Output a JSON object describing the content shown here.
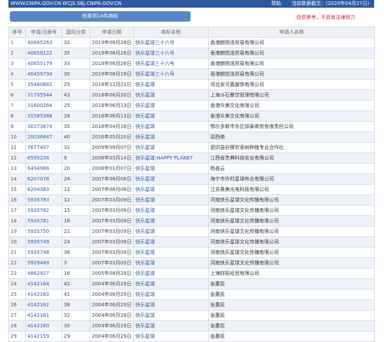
{
  "topbar": {
    "url": "WWW.CNIPA.GOV.CN WCJS.SBJ.CNIPA.GOV.CN",
    "help": "帮助",
    "data_as_of": "当前数据截至：(2020年04月27日)"
  },
  "search": {
    "result_label": "检索到14件商标"
  },
  "disclaimer": "仅供参考，不具有法律效力",
  "table": {
    "headers": [
      "序号",
      "申请/注册号",
      "国际分类",
      "申请日期",
      "商标名称",
      "申请人名称"
    ],
    "rows": [
      {
        "num": "1",
        "reg": "40665263",
        "cls": "32",
        "date": "2019年08月28日",
        "mark": "快乐星球三十六号",
        "applicant": "香港朗悦浩贸易有限公司"
      },
      {
        "num": "2",
        "reg": "40658122",
        "cls": "35",
        "date": "2019年08月28日",
        "mark": "快乐星球三十六号",
        "applicant": "香港朗悦浩贸易有限公司"
      },
      {
        "num": "3",
        "reg": "40655179",
        "cls": "33",
        "date": "2019年08月28日",
        "mark": "快乐星球三十六号",
        "applicant": "香港朗悦浩贸易有限公司"
      },
      {
        "num": "4",
        "reg": "40459734",
        "cls": "30",
        "date": "2019年08月19日",
        "mark": "快乐星球三十六号",
        "applicant": "香港朗悦浩贸易有限公司"
      },
      {
        "num": "5",
        "reg": "35460662",
        "cls": "25",
        "date": "2018年12月21日",
        "mark": "快乐星球",
        "applicant": "河北安可嘉服饰有限公司"
      },
      {
        "num": "6",
        "reg": "31705544",
        "cls": "43",
        "date": "2018年06月20日",
        "mark": "快乐星球",
        "applicant": "上海斗石餐饮管理有限公司"
      },
      {
        "num": "7",
        "reg": "31600264",
        "cls": "25",
        "date": "2018年06月13日",
        "mark": "快乐星球",
        "applicant": "香港众美文化有限公司"
      },
      {
        "num": "8",
        "reg": "31585368",
        "cls": "28",
        "date": "2018年06月13日",
        "mark": "快乐星球",
        "applicant": "香港众美文化有限公司"
      },
      {
        "num": "9",
        "reg": "30273674",
        "cls": "35",
        "date": "2018年04月16日",
        "mark": "快乐星球",
        "applicant": "鄂尔多斯市东区邱泰商贸有限责任公司"
      },
      {
        "num": "10",
        "reg": "20036847",
        "cls": "40",
        "date": "2016年05月20日",
        "mark": "快乐星球",
        "applicant": "梁西艳"
      },
      {
        "num": "11",
        "reg": "7677407",
        "cls": "31",
        "date": "2009年09月07日",
        "mark": "快乐星球",
        "applicant": "泗洪县好楞农家树种植专业合作社"
      },
      {
        "num": "12",
        "reg": "6595226",
        "cls": "9",
        "date": "2008年03月14日",
        "mark": "快乐星球;HAPPY PLANET",
        "applicant": "江西省艺典科技实业有限公司"
      },
      {
        "num": "13",
        "reg": "6494988",
        "cls": "20",
        "date": "2008年01月07日",
        "mark": "快乐星球",
        "applicant": "杨善云"
      },
      {
        "num": "14",
        "reg": "6207078",
        "cls": "24",
        "date": "2007年08月06日",
        "mark": "快乐星球",
        "applicant": "海宁市许村星球布业有限公司"
      },
      {
        "num": "15",
        "reg": "6204383",
        "cls": "12",
        "date": "2007年08月06日",
        "mark": "快乐星球",
        "applicant": "江苏奥美光电科技有限公司"
      },
      {
        "num": "16",
        "reg": "5935783",
        "cls": "12",
        "date": "2007年03月09日",
        "mark": "快乐星球",
        "applicant": "河南快乐星球文化传播有限公司"
      },
      {
        "num": "17",
        "reg": "5935782",
        "cls": "15",
        "date": "2007年03月09日",
        "mark": "快乐星球",
        "applicant": "河南快乐星球文化传播有限公司"
      },
      {
        "num": "18",
        "reg": "5935781",
        "cls": "18",
        "date": "2007年03月09日",
        "mark": "快乐星球",
        "applicant": "河南快乐星球文化传播有限公司"
      },
      {
        "num": "19",
        "reg": "5935750",
        "cls": "21",
        "date": "2007年03月09日",
        "mark": "快乐星球",
        "applicant": "河南快乐星球文化传播有限公司"
      },
      {
        "num": "20",
        "reg": "5935749",
        "cls": "24",
        "date": "2007年03月09日",
        "mark": "快乐星球",
        "applicant": "河南快乐星球文化传播有限公司"
      },
      {
        "num": "21",
        "reg": "5935748",
        "cls": "36",
        "date": "2007年03月09日",
        "mark": "快乐星球",
        "applicant": "河南快乐星球文化传播有限公司"
      },
      {
        "num": "22",
        "reg": "5929489",
        "cls": "3",
        "date": "2007年03月05日",
        "mark": "快乐星球",
        "applicant": "河南快乐星球文化传播有限公司"
      },
      {
        "num": "23",
        "reg": "4862927",
        "cls": "16",
        "date": "2005年08月29日",
        "mark": "快乐星球",
        "applicant": "上海财拓经贸有限公司"
      },
      {
        "num": "24",
        "reg": "4142164",
        "cls": "42",
        "date": "2004年06月29日",
        "mark": "快乐星球",
        "applicant": "张惠民"
      },
      {
        "num": "25",
        "reg": "4142163",
        "cls": "41",
        "date": "2004年06月29日",
        "mark": "快乐星球",
        "applicant": "张惠民"
      },
      {
        "num": "26",
        "reg": "4142162",
        "cls": "38",
        "date": "2004年06月29日",
        "mark": "快乐星球",
        "applicant": "张惠民"
      },
      {
        "num": "27",
        "reg": "4142161",
        "cls": "32",
        "date": "2004年06月29日",
        "mark": "快乐星球",
        "applicant": "张惠民"
      },
      {
        "num": "28",
        "reg": "4142160",
        "cls": "30",
        "date": "2004年06月29日",
        "mark": "快乐星球",
        "applicant": "张惠民"
      },
      {
        "num": "29",
        "reg": "4142159",
        "cls": "29",
        "date": "2004年06月29日",
        "mark": "快乐星球",
        "applicant": "张惠民"
      }
    ]
  }
}
